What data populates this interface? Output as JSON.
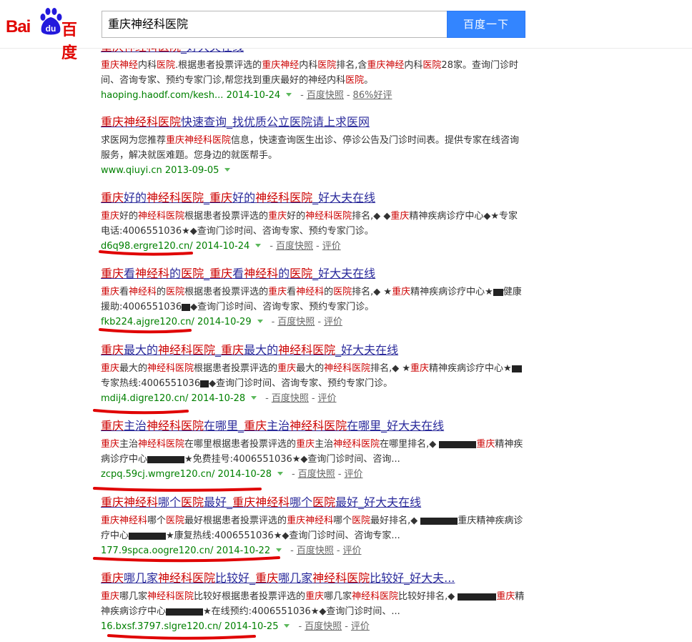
{
  "header": {
    "logo_latin": "Bai",
    "logo_paw_text": "du",
    "logo_cn": "百度",
    "query": "重庆神经科医院",
    "search_button": "百度一下"
  },
  "results": [
    {
      "title": [
        [
          "重庆神经科医院",
          "e"
        ],
        [
          "_好大夫在线",
          ""
        ]
      ],
      "abstract": [
        [
          "重庆神经",
          "e"
        ],
        [
          "内科",
          ""
        ],
        [
          "医院",
          "e"
        ],
        [
          ".根据患者投票评选的",
          ""
        ],
        [
          "重庆神经",
          "e"
        ],
        [
          "内科",
          ""
        ],
        [
          "医院",
          "e"
        ],
        [
          "排名,含",
          ""
        ],
        [
          "重庆神经",
          "e"
        ],
        [
          "内科",
          ""
        ],
        [
          "医院",
          "e"
        ],
        [
          "28家。查询门诊时间、咨询专家、预约专家门诊,帮您找到重庆最好的神经内科",
          ""
        ],
        [
          "医院",
          "e"
        ],
        [
          "。",
          ""
        ]
      ],
      "url": "haoping.haodf.com/kesh... 2014-10-24",
      "links": [
        "百度快照",
        "86%好评"
      ]
    },
    {
      "title": [
        [
          "重庆神经科医院",
          "e"
        ],
        [
          "快速查询_找优质公立医院请上求医网",
          ""
        ]
      ],
      "abstract": [
        [
          "求医网为您推荐",
          ""
        ],
        [
          "重庆神经科医院",
          "e"
        ],
        [
          "信息，快速查询医生出诊、停诊公告及门诊时间表。提供专家在线咨询服务，解决就医难题。您身边的就医帮手。",
          ""
        ]
      ],
      "url": "www.qiuyi.cn 2013-09-05",
      "links": []
    },
    {
      "title": [
        [
          "重庆",
          "e"
        ],
        [
          "好的",
          ""
        ],
        [
          "神经科医院",
          "e"
        ],
        [
          "_",
          ""
        ],
        [
          "重庆",
          "e"
        ],
        [
          "好的",
          ""
        ],
        [
          "神经科医院",
          "e"
        ],
        [
          "_好大夫在线",
          ""
        ]
      ],
      "abstract": [
        [
          "重庆",
          "e"
        ],
        [
          "好的",
          ""
        ],
        [
          "神经科医院",
          "e"
        ],
        [
          "根据患者投票评选的",
          ""
        ],
        [
          "重庆",
          "e"
        ],
        [
          "好的",
          ""
        ],
        [
          "神经科医院",
          "e"
        ],
        [
          "排名,◆ ◆",
          ""
        ],
        [
          "重庆",
          "e"
        ],
        [
          "精神疾病诊疗中心◆★专家电话:4006551036★◆查询门诊时间、咨询专家、预约专家门诊。",
          ""
        ]
      ],
      "url": "d6q98.ergre120.cn/ 2014-10-24",
      "links": [
        "百度快照",
        "评价"
      ]
    },
    {
      "title": [
        [
          "重庆",
          "e"
        ],
        [
          "看",
          ""
        ],
        [
          "神经科",
          "e"
        ],
        [
          "的",
          ""
        ],
        [
          "医院",
          "e"
        ],
        [
          "_",
          ""
        ],
        [
          "重庆",
          "e"
        ],
        [
          "看",
          ""
        ],
        [
          "神经科",
          "e"
        ],
        [
          "的",
          ""
        ],
        [
          "医院",
          "e"
        ],
        [
          "_好大夫在线",
          ""
        ]
      ],
      "abstract": [
        [
          "重庆",
          "e"
        ],
        [
          "看",
          ""
        ],
        [
          "神经科",
          "e"
        ],
        [
          "的",
          ""
        ],
        [
          "医院",
          "e"
        ],
        [
          "根据患者投票评选的",
          ""
        ],
        [
          "重庆",
          "e"
        ],
        [
          "看",
          ""
        ],
        [
          "神经科",
          "e"
        ],
        [
          "的",
          ""
        ],
        [
          "医院",
          "e"
        ],
        [
          "排名,◆ ★",
          ""
        ],
        [
          "重庆",
          "e"
        ],
        [
          "精神疾病诊疗中心★",
          ""
        ],
        [
          "R14",
          ""
        ],
        [
          "健康援助:4006551036",
          ""
        ],
        [
          "R12",
          ""
        ],
        [
          "◆查询门诊时间、咨询专家、预约专家门诊。",
          ""
        ]
      ],
      "url": "fkb224.ajgre120.cn/ 2014-10-29",
      "links": [
        "百度快照",
        "评价"
      ]
    },
    {
      "title": [
        [
          "重庆",
          "e"
        ],
        [
          "最大的",
          ""
        ],
        [
          "神经科医院",
          "e"
        ],
        [
          "_",
          ""
        ],
        [
          "重庆",
          "e"
        ],
        [
          "最大的",
          ""
        ],
        [
          "神经科医院",
          "e"
        ],
        [
          "_好大夫在线",
          ""
        ]
      ],
      "abstract": [
        [
          "重庆",
          "e"
        ],
        [
          "最大的",
          ""
        ],
        [
          "神经科医院",
          "e"
        ],
        [
          "根据患者投票评选的",
          ""
        ],
        [
          "重庆",
          "e"
        ],
        [
          "最大的",
          ""
        ],
        [
          "神经科医院",
          "e"
        ],
        [
          "排名,◆ ★",
          ""
        ],
        [
          "重庆",
          "e"
        ],
        [
          "精神疾病诊疗中心★",
          ""
        ],
        [
          "R14",
          ""
        ],
        [
          "专家热线:4006551036",
          ""
        ],
        [
          "R12",
          ""
        ],
        [
          "◆查询门诊时间、咨询专家、预约专家门诊。",
          ""
        ]
      ],
      "url": "mdij4.digre120.cn/ 2014-10-28",
      "links": [
        "百度快照",
        "评价"
      ]
    },
    {
      "title": [
        [
          "重庆",
          "e"
        ],
        [
          "主治",
          ""
        ],
        [
          "神经科医院",
          "e"
        ],
        [
          "在哪里_",
          ""
        ],
        [
          "重庆",
          "e"
        ],
        [
          "主治",
          ""
        ],
        [
          "神经科医院",
          "e"
        ],
        [
          "在哪里_好大夫在线",
          ""
        ]
      ],
      "abstract": [
        [
          "重庆",
          "e"
        ],
        [
          "主治",
          ""
        ],
        [
          "神经科医院",
          "e"
        ],
        [
          "在哪里根据患者投票评选的",
          ""
        ],
        [
          "重庆",
          "e"
        ],
        [
          "主治",
          ""
        ],
        [
          "神经科医院",
          "e"
        ],
        [
          "在哪里排名,◆ ",
          ""
        ],
        [
          "R52",
          ""
        ],
        [
          "重庆",
          "e"
        ],
        [
          "精神疾病诊疗中心",
          ""
        ],
        [
          "R52",
          ""
        ],
        [
          "★免费挂号:4006551036★◆查询门诊时间、咨询...",
          ""
        ]
      ],
      "url": "zcpq.59cj.wmgre120.cn/ 2014-10-28",
      "links": [
        "百度快照",
        "评价"
      ]
    },
    {
      "title": [
        [
          "重庆神经科",
          "e"
        ],
        [
          "哪个",
          ""
        ],
        [
          "医院",
          "e"
        ],
        [
          "最好_",
          ""
        ],
        [
          "重庆神经科",
          "e"
        ],
        [
          "哪个",
          ""
        ],
        [
          "医院",
          "e"
        ],
        [
          "最好_好大夫在线",
          ""
        ]
      ],
      "abstract": [
        [
          "重庆神经科",
          "e"
        ],
        [
          "哪个",
          ""
        ],
        [
          "医院",
          "e"
        ],
        [
          "最好根据患者投票评选的",
          ""
        ],
        [
          "重庆神经科",
          "e"
        ],
        [
          "哪个",
          ""
        ],
        [
          "医院",
          "e"
        ],
        [
          "最好排名,◆ ",
          ""
        ],
        [
          "R52",
          ""
        ],
        [
          "重庆精神疾病诊疗中心",
          ""
        ],
        [
          "R52",
          ""
        ],
        [
          "★康复热线:4006551036★◆查询门诊时间、咨询专家...",
          ""
        ]
      ],
      "url": "177.9spca.oogre120.cn/ 2014-10-22",
      "links": [
        "百度快照",
        "评价"
      ]
    },
    {
      "title": [
        [
          "重庆",
          "e"
        ],
        [
          "哪几家",
          ""
        ],
        [
          "神经科医院",
          "e"
        ],
        [
          "比较好_",
          ""
        ],
        [
          "重庆",
          "e"
        ],
        [
          "哪几家",
          ""
        ],
        [
          "神经科医院",
          "e"
        ],
        [
          "比较好_好大夫...",
          ""
        ]
      ],
      "abstract": [
        [
          "重庆",
          "e"
        ],
        [
          "哪几家",
          ""
        ],
        [
          "神经科医院",
          "e"
        ],
        [
          "比较好根据患者投票评选的",
          ""
        ],
        [
          "重庆",
          "e"
        ],
        [
          "哪几家",
          ""
        ],
        [
          "神经科医院",
          "e"
        ],
        [
          "比较好排名,◆ ",
          ""
        ],
        [
          "R40",
          ""
        ],
        [
          "R14",
          ""
        ],
        [
          "重庆",
          "e"
        ],
        [
          "精神疾病诊疗中心",
          ""
        ],
        [
          "R52",
          ""
        ],
        [
          "★在线预约:4006551036★◆查询门诊时间、...",
          ""
        ]
      ],
      "url": "16.bxsf.3797.slgre120.cn/ 2014-10-25",
      "links": [
        "百度快照",
        "评价"
      ]
    }
  ],
  "colors": {
    "title_link": "#2a2a9b",
    "keyword": "#cc0000",
    "url": "#008000",
    "button": "#3385ff",
    "annotation": "#e00000"
  }
}
